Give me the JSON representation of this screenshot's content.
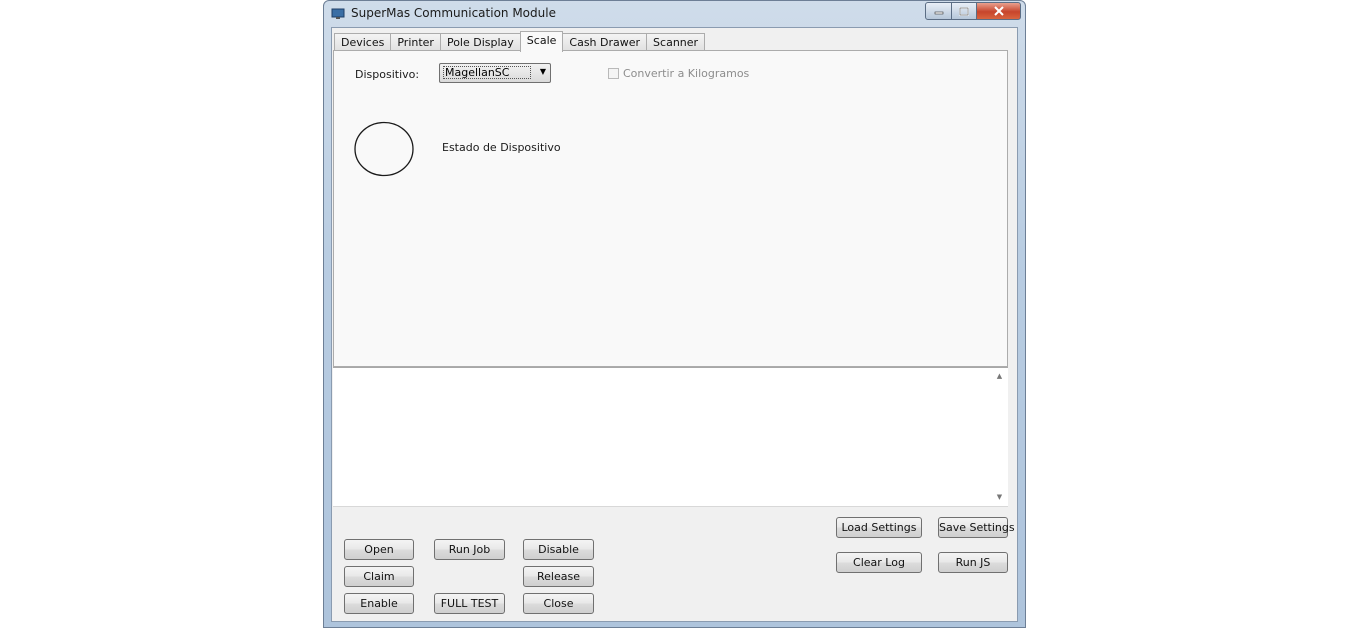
{
  "window": {
    "title": "SuperMas Communication Module"
  },
  "tabs": [
    "Devices",
    "Printer",
    "Pole Display",
    "Scale",
    "Cash Drawer",
    "Scanner"
  ],
  "active_tab": "Scale",
  "scale_panel": {
    "device_label": "Dispositivo:",
    "device_value": "MagellanSC",
    "convert_label": "Convertir a Kilogramos",
    "convert_checked": false,
    "status_label": "Estado de Dispositivo"
  },
  "buttons": {
    "open": "Open",
    "claim": "Claim",
    "enable": "Enable",
    "run_job": "Run Job",
    "full_test": "FULL TEST",
    "disable": "Disable",
    "release": "Release",
    "close": "Close",
    "load_settings": "Load Settings",
    "save_settings": "Save Settings",
    "clear_log": "Clear Log",
    "run_js": "Run JS"
  },
  "icons": {
    "app": "monitor-icon",
    "minimize": "minimize-icon",
    "maximize": "maximize-icon",
    "close": "close-icon",
    "dropdown": "chevron-down-icon",
    "scroll_up": "scroll-up-icon",
    "scroll_down": "scroll-down-icon"
  }
}
